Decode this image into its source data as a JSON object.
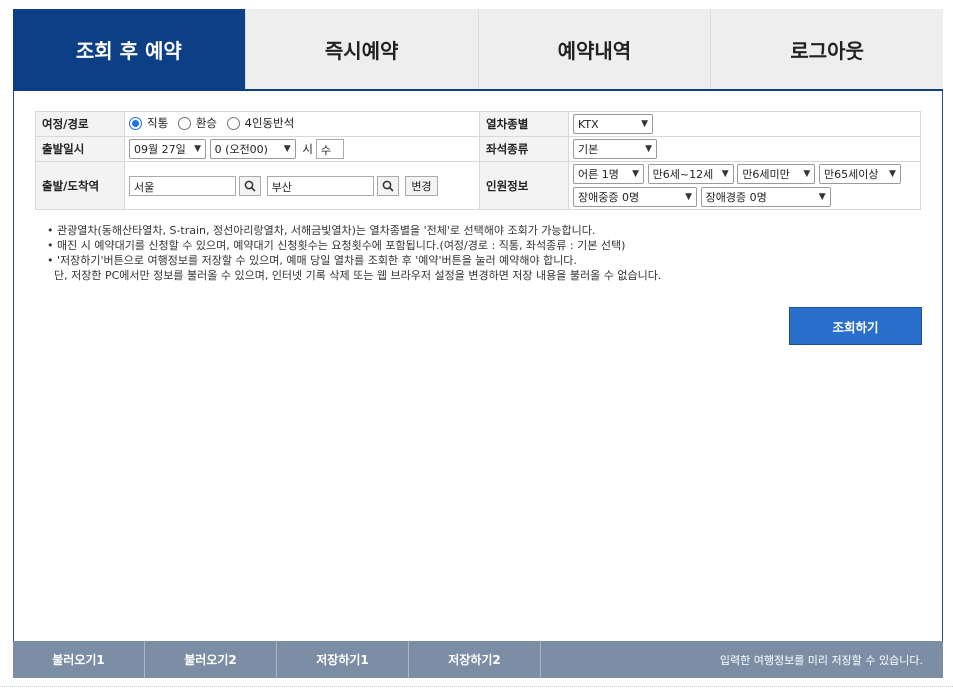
{
  "tabs": [
    {
      "label": "조회 후 예약",
      "active": true
    },
    {
      "label": "즉시예약"
    },
    {
      "label": "예약내역"
    },
    {
      "label": "로그아웃"
    }
  ],
  "form": {
    "route": {
      "label": "여정/경로",
      "options": [
        "직통",
        "환승",
        "4인동반석"
      ],
      "selected": "직통"
    },
    "train_type": {
      "label": "열차종별",
      "value": "KTX"
    },
    "departure_date": {
      "label": "출발일시",
      "date": "09월 27일",
      "time": "0 (오전00)",
      "hour_suffix": "시",
      "weekday": "수"
    },
    "seat_type": {
      "label": "좌석종류",
      "value": "기본"
    },
    "stations": {
      "label": "출발/도착역",
      "from": "서울",
      "to": "부산",
      "change_label": "변경"
    },
    "passengers": {
      "label": "인원정보",
      "adult": "어른 1명",
      "child": "만6세~12세",
      "infant": "만6세미만",
      "senior": "만65세이상",
      "disabled_severe": "장애중증 0명",
      "disabled_mild": "장애경증 0명"
    }
  },
  "notes": [
    "• 관광열차(동해산타열차, S-train, 정선아리랑열차, 서해금빛열차)는 열차종별을 '전체'로 선택해야 조회가 가능합니다.",
    "• 매진 시 예약대기를 신청할 수 있으며, 예약대기 신청횟수는 요청횟수에 포함됩니다.(여정/경로 : 직통, 좌석종류 : 기본 선택)",
    "• '저장하기'버튼으로 여행정보를 저장할 수 있으며, 예매 당일 열차를 조회한 후 '예약'버튼을 눌러 예약해야 합니다.",
    "  단, 저장한 PC에서만 정보를 불러올 수 있으며, 인터넷 기록 삭제 또는 웹 브라우저 설정을 변경하면 저장 내용을 불러올 수 없습니다."
  ],
  "search_button": "조회하기",
  "bottom": {
    "buttons": [
      "불러오기1",
      "불러오기2",
      "저장하기1",
      "저장하기2"
    ],
    "note": "입력한 여행정보를 미리 저장할 수 있습니다."
  },
  "colors": {
    "active_tab": "#0d3f87",
    "search_button": "#2a6fc9",
    "bottom_bar": "#7c8ea6"
  }
}
